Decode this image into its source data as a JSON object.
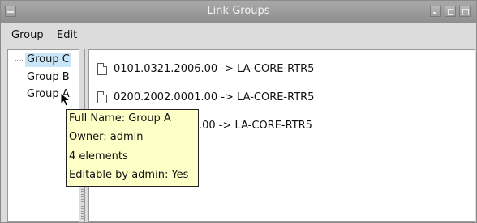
{
  "window": {
    "title": "Link Groups"
  },
  "menubar": {
    "group": "Group",
    "edit": "Edit"
  },
  "tree": {
    "items": [
      {
        "label": "Group C",
        "selected": true
      },
      {
        "label": "Group B",
        "selected": false
      },
      {
        "label": "Group A",
        "selected": false
      }
    ]
  },
  "list": {
    "items": [
      {
        "text": "0101.0321.2006.00 -> LA-CORE-RTR5"
      },
      {
        "text": "0200.2002.0001.00 -> LA-CORE-RTR5"
      },
      {
        "text": ".00 -> LA-CORE-RTR5"
      }
    ]
  },
  "tooltip": {
    "full_name": "Full Name: Group A",
    "owner": "Owner: admin",
    "elements": "4 elements",
    "editable": "Editable by admin: Yes"
  },
  "colors": {
    "selection": "#c8e6f8",
    "tooltip_bg": "#ffffc8",
    "titlebar": "#9c9c9c"
  }
}
